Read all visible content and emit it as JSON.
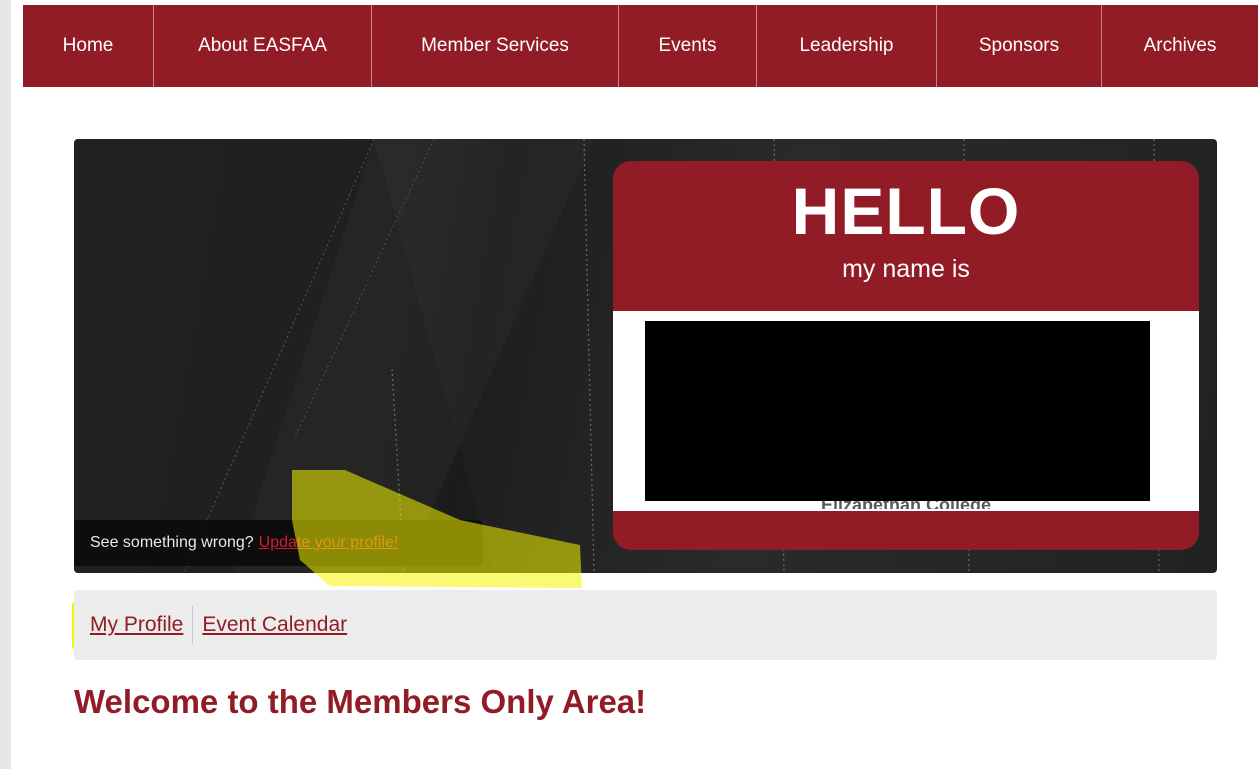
{
  "nav": {
    "items": [
      {
        "label": "Home"
      },
      {
        "label": "About EASFAA"
      },
      {
        "label": "Member Services"
      },
      {
        "label": "Events"
      },
      {
        "label": "Leadership"
      },
      {
        "label": "Sponsors"
      },
      {
        "label": "Archives"
      }
    ]
  },
  "hero": {
    "hello": "HELLO",
    "my_name_is": "my name is",
    "org_fragment": "Elizabethan College",
    "notice_text": "See something wrong?",
    "notice_link": "Update your profile!"
  },
  "subnav": {
    "my_profile": "My Profile",
    "event_calendar": "Event Calendar"
  },
  "welcome": "Welcome to the Members Only Area!",
  "colors": {
    "brand": "#921c26",
    "highlight": "#f6f400"
  }
}
